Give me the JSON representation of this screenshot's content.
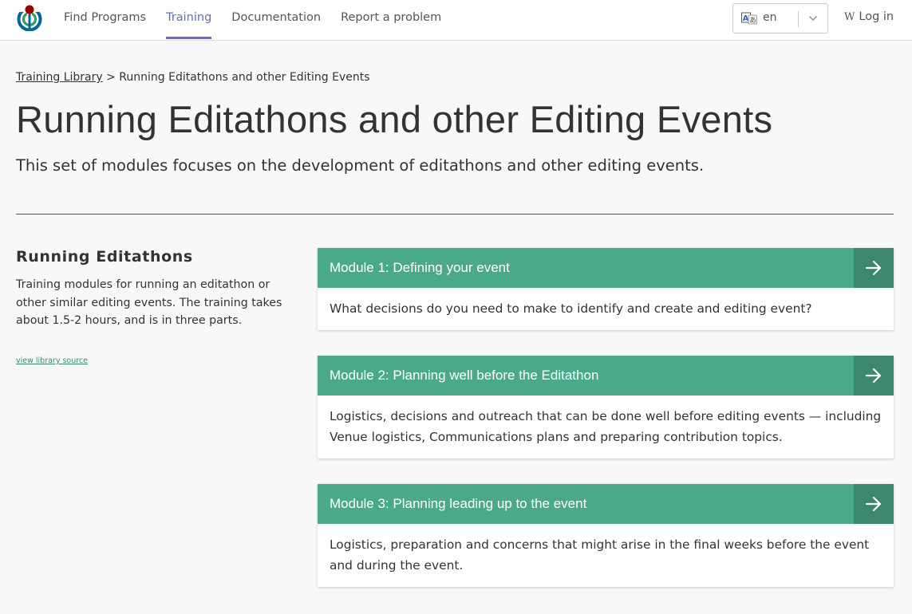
{
  "nav": {
    "items": [
      {
        "label": "Find Programs",
        "active": false
      },
      {
        "label": "Training",
        "active": true
      },
      {
        "label": "Documentation",
        "active": false
      },
      {
        "label": "Report a problem",
        "active": false
      }
    ],
    "language": "en",
    "login_icon": "W",
    "login_label": "Log in"
  },
  "breadcrumb": {
    "library_link": "Training Library",
    "separator": ">",
    "current": "Running Editathons and other Editing Events"
  },
  "page": {
    "title": "Running Editathons and other Editing Events",
    "subtitle": "This set of modules focuses on the development of editathons and other editing events."
  },
  "library": {
    "heading": "Running Editathons",
    "description": "Training modules for running an editathon or other similar editing events. The training takes about 1.5-2 hours, and is in three parts.",
    "source_link": "view library source"
  },
  "modules": [
    {
      "title": "Module 1: Defining your event",
      "description": "What decisions do you need to make to identify and create and editing event?"
    },
    {
      "title": "Module 2: Planning well before the Editathon",
      "description": "Logistics, decisions and outreach that can be done well before editing events — including Venue logistics, Communications plans and preparing contribution topics."
    },
    {
      "title": "Module 3: Planning leading up to the event",
      "description": "Logistics, preparation and concerns that might arise in the final weeks before the event and during the event."
    }
  ],
  "colors": {
    "accent": "#676eb4",
    "module_header": "#4aa98a",
    "module_arrow": "#3d8670",
    "link_green": "#3a8a6c"
  }
}
